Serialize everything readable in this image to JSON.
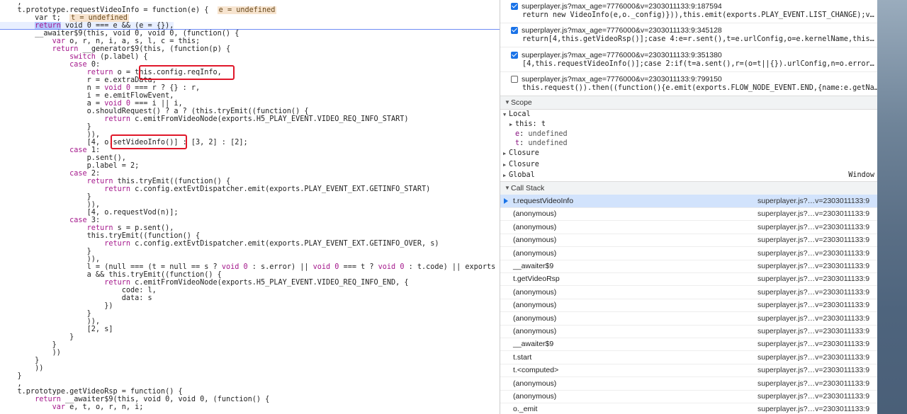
{
  "code": {
    "lines": [
      {
        "segs": [
          {
            "t": "    ,"
          }
        ]
      },
      {
        "segs": [
          {
            "t": "    t.prototype.requestVideoInfo = function(e) {  "
          },
          {
            "t": "e = undefined",
            "c": "inl"
          }
        ]
      },
      {
        "segs": [
          {
            "t": "        var t;  "
          },
          {
            "t": "t = undefined",
            "c": "inl"
          }
        ]
      },
      {
        "current": true,
        "segs": [
          {
            "t": "        "
          },
          {
            "t": "return",
            "c": "kwsel"
          },
          {
            "t": " void 0 === e && (e = {}),"
          }
        ]
      },
      {
        "segs": [
          {
            "t": "        __awaiter$9(this, void 0, void 0, (function() {"
          }
        ]
      },
      {
        "segs": [
          {
            "t": "            "
          },
          {
            "t": "var",
            "c": "kw"
          },
          {
            "t": " o, r, n, i, a, s, l, c = this;"
          }
        ]
      },
      {
        "segs": [
          {
            "t": "            "
          },
          {
            "t": "return",
            "c": "kw"
          },
          {
            "t": " __generator$9(this, (function(p) {"
          }
        ]
      },
      {
        "segs": [
          {
            "t": "                "
          },
          {
            "t": "switch",
            "c": "kw"
          },
          {
            "t": " (p.label) {"
          }
        ]
      },
      {
        "segs": [
          {
            "t": "                "
          },
          {
            "t": "case",
            "c": "kw"
          },
          {
            "t": " 0:"
          }
        ]
      },
      {
        "segs": [
          {
            "t": "                    "
          },
          {
            "t": "return",
            "c": "kw"
          },
          {
            "t": " o = this.config.reqInfo,"
          }
        ]
      },
      {
        "segs": [
          {
            "t": "                    r = e.extraData,"
          }
        ]
      },
      {
        "segs": [
          {
            "t": "                    n = "
          },
          {
            "t": "void 0",
            "c": "kw"
          },
          {
            "t": " === r ? {} : r,"
          }
        ]
      },
      {
        "segs": [
          {
            "t": "                    i = e.emitFlowEvent,"
          }
        ]
      },
      {
        "segs": [
          {
            "t": "                    a = "
          },
          {
            "t": "void 0",
            "c": "kw"
          },
          {
            "t": " === i || i,"
          }
        ]
      },
      {
        "segs": [
          {
            "t": "                    o.shouldRequest() ? a ? (this.tryEmit((function() {"
          }
        ]
      },
      {
        "segs": [
          {
            "t": "                        "
          },
          {
            "t": "return",
            "c": "kw"
          },
          {
            "t": " c.emitFromVideoNode(exports.H5_PLAY_EVENT.VIDEO_REQ_INFO_START)"
          }
        ]
      },
      {
        "segs": [
          {
            "t": "                    }"
          }
        ]
      },
      {
        "segs": [
          {
            "t": "                    )),"
          }
        ]
      },
      {
        "segs": [
          {
            "t": "                    [4, o.setVideoInfo()] : [3, 2] : [2];"
          }
        ]
      },
      {
        "segs": [
          {
            "t": "                "
          },
          {
            "t": "case",
            "c": "kw"
          },
          {
            "t": " 1:"
          }
        ]
      },
      {
        "segs": [
          {
            "t": "                    p.sent(),"
          }
        ]
      },
      {
        "segs": [
          {
            "t": "                    p.label = 2;"
          }
        ]
      },
      {
        "segs": [
          {
            "t": "                "
          },
          {
            "t": "case",
            "c": "kw"
          },
          {
            "t": " 2:"
          }
        ]
      },
      {
        "segs": [
          {
            "t": "                    "
          },
          {
            "t": "return",
            "c": "kw"
          },
          {
            "t": " this.tryEmit((function() {"
          }
        ]
      },
      {
        "segs": [
          {
            "t": "                        "
          },
          {
            "t": "return",
            "c": "kw"
          },
          {
            "t": " c.config.extEvtDispatcher.emit(exports.PLAY_EVENT_EXT.GETINFO_START)"
          }
        ]
      },
      {
        "segs": [
          {
            "t": "                    }"
          }
        ]
      },
      {
        "segs": [
          {
            "t": "                    )),"
          }
        ]
      },
      {
        "segs": [
          {
            "t": "                    [4, o.requestVod(n)];"
          }
        ]
      },
      {
        "segs": [
          {
            "t": "                "
          },
          {
            "t": "case",
            "c": "kw"
          },
          {
            "t": " 3:"
          }
        ]
      },
      {
        "segs": [
          {
            "t": "                    "
          },
          {
            "t": "return",
            "c": "kw"
          },
          {
            "t": " s = p.sent(),"
          }
        ]
      },
      {
        "segs": [
          {
            "t": "                    this.tryEmit((function() {"
          }
        ]
      },
      {
        "segs": [
          {
            "t": "                        "
          },
          {
            "t": "return",
            "c": "kw"
          },
          {
            "t": " c.config.extEvtDispatcher.emit(exports.PLAY_EVENT_EXT.GETINFO_OVER, s)"
          }
        ]
      },
      {
        "segs": [
          {
            "t": "                    }"
          }
        ]
      },
      {
        "segs": [
          {
            "t": "                    )),"
          }
        ]
      },
      {
        "segs": [
          {
            "t": "                    l = (null === (t = null == s ? "
          },
          {
            "t": "void 0",
            "c": "kw"
          },
          {
            "t": " : s.error) || "
          },
          {
            "t": "void 0",
            "c": "kw"
          },
          {
            "t": " === t ? "
          },
          {
            "t": "void 0",
            "c": "kw"
          },
          {
            "t": " : t.code) || exports"
          }
        ]
      },
      {
        "segs": [
          {
            "t": "                    a && this.tryEmit((function() {"
          }
        ]
      },
      {
        "segs": [
          {
            "t": "                        "
          },
          {
            "t": "return",
            "c": "kw"
          },
          {
            "t": " c.emitFromVideoNode(exports.H5_PLAY_EVENT.VIDEO_REQ_INFO_END, {"
          }
        ]
      },
      {
        "segs": [
          {
            "t": "                            code: l,"
          }
        ]
      },
      {
        "segs": [
          {
            "t": "                            data: s"
          }
        ]
      },
      {
        "segs": [
          {
            "t": "                        })"
          }
        ]
      },
      {
        "segs": [
          {
            "t": "                    }"
          }
        ]
      },
      {
        "segs": [
          {
            "t": "                    )),"
          }
        ]
      },
      {
        "segs": [
          {
            "t": "                    [2, s]"
          }
        ]
      },
      {
        "segs": [
          {
            "t": "                }"
          }
        ]
      },
      {
        "segs": [
          {
            "t": "            }"
          }
        ]
      },
      {
        "segs": [
          {
            "t": "            ))"
          }
        ]
      },
      {
        "segs": [
          {
            "t": "        }"
          }
        ]
      },
      {
        "segs": [
          {
            "t": "        ))"
          }
        ]
      },
      {
        "segs": [
          {
            "t": "    }"
          }
        ]
      },
      {
        "segs": [
          {
            "t": "    ,"
          }
        ]
      },
      {
        "segs": [
          {
            "t": "    t.prototype.getVideoRsp = function() {"
          }
        ]
      },
      {
        "segs": [
          {
            "t": "        "
          },
          {
            "t": "return",
            "c": "kw"
          },
          {
            "t": " __awaiter$9(this, void 0, void 0, (function() {"
          }
        ]
      },
      {
        "segs": [
          {
            "t": "            "
          },
          {
            "t": "var",
            "c": "kw"
          },
          {
            "t": " e, t, o, r, n, i;"
          }
        ]
      }
    ]
  },
  "breakpoints": [
    {
      "checked": true,
      "location": "superplayer.js?max_age=7776000&v=2303011133:9:187594",
      "source": "return new VideoInfo(e,o._config)})),this.emit(exports.PLAY_EVENT.LIST_CHANGE);v…"
    },
    {
      "checked": true,
      "location": "superplayer.js?max_age=7776000&v=2303011133:9:345128",
      "source": "return[4,this.getVideoRsp()];case 4:e=r.sent(),t=e.urlConfig,o=e.kernelName,this…"
    },
    {
      "checked": true,
      "location": "superplayer.js?max_age=7776000&v=2303011133:9:351380",
      "source": "[4,this.requestVideoInfo()];case 2:if(t=a.sent(),r=(o=t||{}).urlConfig,n=o.error…"
    },
    {
      "checked": false,
      "location": "superplayer.js?max_age=7776000&v=2303011133:9:799150",
      "source": "this.request()).then((function(){e.emit(exports.FLOW_NODE_EVENT.END,{name:e.getNa…"
    }
  ],
  "scope": {
    "title": "Scope",
    "local": "Local",
    "this_name": "this",
    "this_value": "t",
    "e_name": "e",
    "e_value": "undefined",
    "t_name": "t",
    "t_value": "undefined",
    "closure1": "Closure",
    "closure2": "Closure",
    "global": "Global",
    "global_value": "Window"
  },
  "callstack": {
    "title": "Call Stack",
    "frames": [
      {
        "fn": "t.requestVideoInfo",
        "src": "superplayer.js?…v=2303011133:9",
        "active": true
      },
      {
        "fn": "(anonymous)",
        "src": "superplayer.js?…v=2303011133:9"
      },
      {
        "fn": "(anonymous)",
        "src": "superplayer.js?…v=2303011133:9"
      },
      {
        "fn": "(anonymous)",
        "src": "superplayer.js?…v=2303011133:9"
      },
      {
        "fn": "(anonymous)",
        "src": "superplayer.js?…v=2303011133:9"
      },
      {
        "fn": "__awaiter$9",
        "src": "superplayer.js?…v=2303011133:9"
      },
      {
        "fn": "t.getVideoRsp",
        "src": "superplayer.js?…v=2303011133:9"
      },
      {
        "fn": "(anonymous)",
        "src": "superplayer.js?…v=2303011133:9"
      },
      {
        "fn": "(anonymous)",
        "src": "superplayer.js?…v=2303011133:9"
      },
      {
        "fn": "(anonymous)",
        "src": "superplayer.js?…v=2303011133:9"
      },
      {
        "fn": "(anonymous)",
        "src": "superplayer.js?…v=2303011133:9"
      },
      {
        "fn": "__awaiter$9",
        "src": "superplayer.js?…v=2303011133:9"
      },
      {
        "fn": "t.start",
        "src": "superplayer.js?…v=2303011133:9"
      },
      {
        "fn": "t.<computed>",
        "src": "superplayer.js?…v=2303011133:9"
      },
      {
        "fn": "(anonymous)",
        "src": "superplayer.js?…v=2303011133:9"
      },
      {
        "fn": "(anonymous)",
        "src": "superplayer.js?…v=2303011133:9"
      },
      {
        "fn": "o._emit",
        "src": "superplayer.js?…v=2303011133:9"
      }
    ]
  },
  "colors": {
    "highlight_box": "#e0172a",
    "keyword": "#a4178b",
    "active_frame": "#d2e3fc",
    "checkbox": "#1a73e8"
  }
}
